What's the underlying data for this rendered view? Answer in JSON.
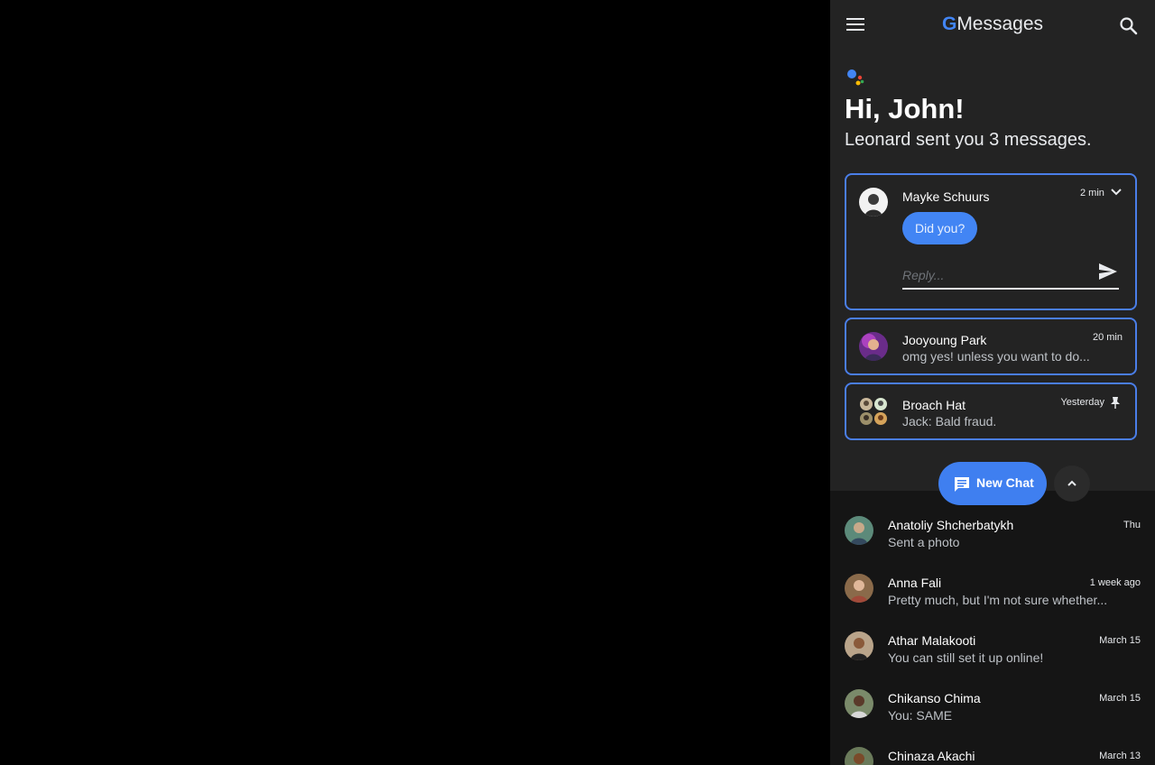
{
  "header": {
    "title_g": "G",
    "title": "Messages",
    "menu_icon": "menu-icon",
    "search_icon": "search-icon"
  },
  "assistant": {
    "greeting": "Hi, John!",
    "summary": "Leonard sent you 3 messages."
  },
  "cards": [
    {
      "name": "Mayke Schuurs",
      "time": "2 min",
      "message": "Did you?",
      "reply_placeholder": "Reply...",
      "expanded": true
    },
    {
      "name": "Jooyoung Park",
      "time": "20 min",
      "preview": "omg yes! unless you want to do..."
    },
    {
      "name": "Broach Hat",
      "time": "Yesterday",
      "preview": "Jack: Bald fraud.",
      "pinned": true
    }
  ],
  "actions": {
    "new_chat_label": "New Chat"
  },
  "conversations": [
    {
      "name": "Anatoliy Shcherbatykh",
      "time": "Thu",
      "preview": "Sent a photo"
    },
    {
      "name": "Anna Fali",
      "time": "1 week ago",
      "preview": "Pretty much, but I'm not sure whether..."
    },
    {
      "name": "Athar Malakooti",
      "time": "March 15",
      "preview": "You can still set it up online!"
    },
    {
      "name": "Chikanso Chima",
      "time": "March 15",
      "preview": "You: SAME"
    },
    {
      "name": "Chinaza Akachi",
      "time": "March 13",
      "preview": ""
    }
  ],
  "colors": {
    "accent": "#4285f4",
    "panel": "#232323",
    "list": "#151515"
  }
}
